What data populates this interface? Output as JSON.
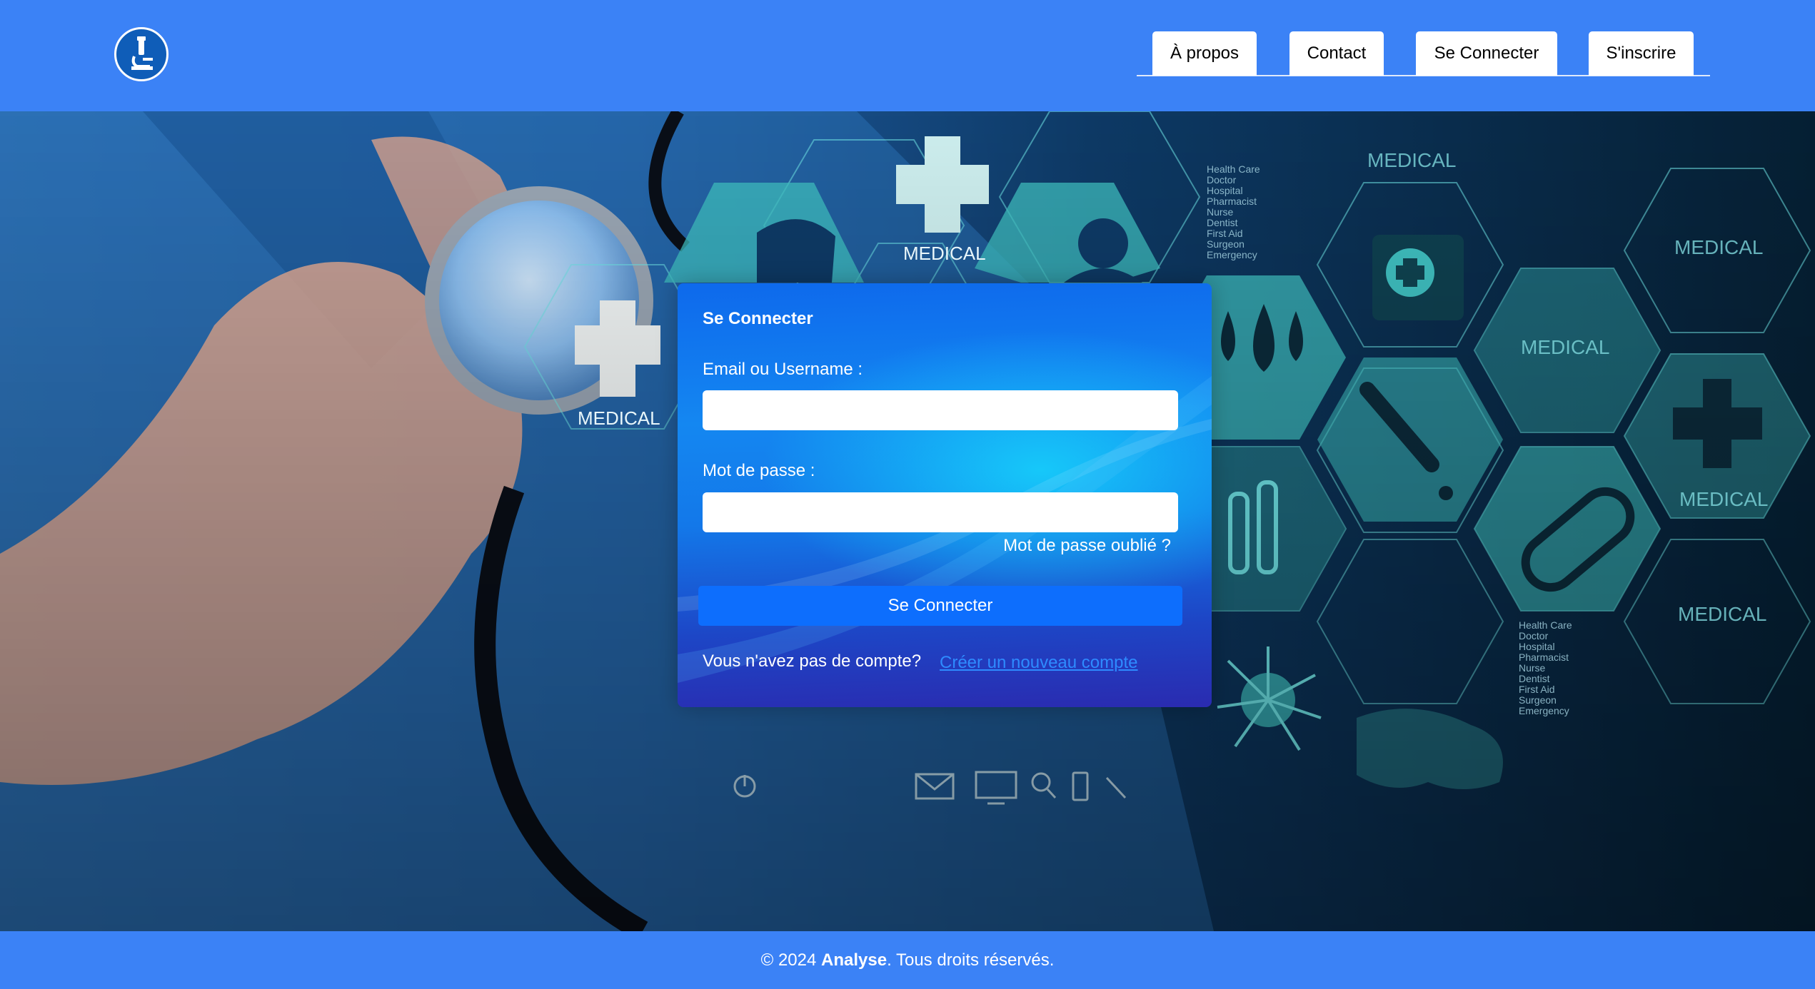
{
  "header": {
    "nav": {
      "about": "À propos",
      "contact": "Contact",
      "login": "Se Connecter",
      "signup": "S'inscrire"
    }
  },
  "hero": {
    "labels": {
      "medical": "MEDICAL",
      "care_list": [
        "Health Care",
        "Doctor",
        "Hospital",
        "Pharmacist",
        "Nurse",
        "Dentist",
        "First Aid",
        "Surgeon",
        "Emergency"
      ]
    }
  },
  "login_form": {
    "title": "Se Connecter",
    "email_label": "Email ou Username :",
    "email_value": "",
    "password_label": "Mot de passe :",
    "password_value": "",
    "forgot_password": "Mot de passe oublié ?",
    "submit_label": "Se Connecter",
    "no_account_text": "Vous n'avez pas de compte?",
    "create_account_link": "Créer un nouveau compte"
  },
  "footer": {
    "copyright_prefix": "© 2024 ",
    "brand": "Analyse",
    "copyright_suffix": ". Tous droits réservés."
  },
  "colors": {
    "header_bg": "#3b82f6",
    "footer_bg": "#3b82f6",
    "primary_button": "#0d6efd",
    "link": "#2e8bff",
    "hero_teal": "#3fbfc0"
  }
}
